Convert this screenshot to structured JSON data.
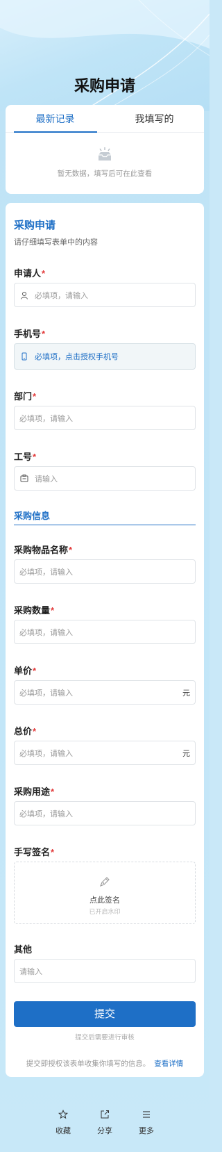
{
  "header": {
    "title": "采购申请"
  },
  "tabs": [
    {
      "label": "最新记录",
      "active": true
    },
    {
      "label": "我填写的",
      "active": false
    }
  ],
  "empty_state": {
    "icon": "inbox-icon",
    "text": "暂无数据，填写后可在此查看"
  },
  "form": {
    "title": "采购申请",
    "description": "请仔细填写表单中的内容",
    "fields": {
      "applicant": {
        "label": "申请人",
        "required_mark": "*",
        "placeholder": "必填项，请输入",
        "icon": "user-icon"
      },
      "phone": {
        "label": "手机号",
        "required_mark": "*",
        "placeholder": "必填项，点击授权手机号",
        "icon": "phone-icon"
      },
      "department": {
        "label": "部门",
        "required_mark": "*",
        "placeholder": "必填项，请输入"
      },
      "employee_id": {
        "label": "工号",
        "required_mark": "*",
        "placeholder": "请输入",
        "icon": "id-card-icon"
      },
      "item_name": {
        "label": "采购物品名称",
        "required_mark": "*",
        "placeholder": "必填项，请输入"
      },
      "quantity": {
        "label": "采购数量",
        "required_mark": "*",
        "placeholder": "必填项，请输入"
      },
      "unit_price": {
        "label": "单价",
        "required_mark": "*",
        "placeholder": "必填项，请输入",
        "suffix": "元"
      },
      "total_price": {
        "label": "总价",
        "required_mark": "*",
        "placeholder": "必填项，请输入",
        "suffix": "元"
      },
      "purpose": {
        "label": "采购用途",
        "required_mark": "*",
        "placeholder": "必填项，请输入"
      },
      "signature": {
        "label": "手写签名",
        "required_mark": "*",
        "text": "点此签名",
        "subtext": "已开启水印",
        "icon": "pen-icon"
      },
      "other": {
        "label": "其他",
        "placeholder": "请输入"
      }
    },
    "section_purchase": "采购信息",
    "submit_label": "提交",
    "submit_note": "提交后需要进行审核",
    "privacy_text": "提交即授权该表单收集你填写的信息。",
    "privacy_link": "查看详情"
  },
  "bottom_bar": [
    {
      "label": "收藏",
      "icon": "star-icon"
    },
    {
      "label": "分享",
      "icon": "share-icon"
    },
    {
      "label": "更多",
      "icon": "menu-icon"
    }
  ],
  "colors": {
    "accent": "#1e6fc6",
    "required": "#e23b3b",
    "background": "#c9e8f8"
  }
}
